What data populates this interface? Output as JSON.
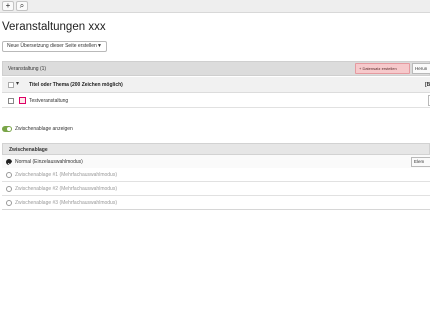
{
  "toolbar": {
    "buttons": [
      {
        "icon": "plus-icon",
        "glyph": "+"
      },
      {
        "icon": "search-icon",
        "glyph": "⌕"
      }
    ]
  },
  "page": {
    "title": "Veranstaltungen xxx",
    "translation_select": "Neue Übersetzung dieser Seite erstellen"
  },
  "records": {
    "table_title": "Veranstaltung (1)",
    "new_record_label": "+ Datensatz erstellen",
    "hidden_button_label": "Herun",
    "column_label": "Titel oder Thema (200 Zeichen möglich)",
    "column_extra": "[B",
    "rows": [
      {
        "label": "Testveranstaltung"
      }
    ]
  },
  "clipboard": {
    "toggle_label": "Zwischenablage anzeigen",
    "toggle_on": true,
    "header": "Zwischenablage",
    "element_button": "Elem",
    "rows": [
      {
        "label": "Normal (Einzelauswahlmodus)",
        "selected": true
      },
      {
        "label": "Zwischenablage #1 (Mehrfachauswahlmodus)",
        "selected": false
      },
      {
        "label": "Zwischenablage #2 (Mehrfachauswahlmodus)",
        "selected": false
      },
      {
        "label": "Zwischenablage #3 (Mehrfachauswahlmodus)",
        "selected": false
      }
    ]
  },
  "colors": {
    "new_record_highlight": "#f6c9cb",
    "toggle_on": "#79a548"
  }
}
